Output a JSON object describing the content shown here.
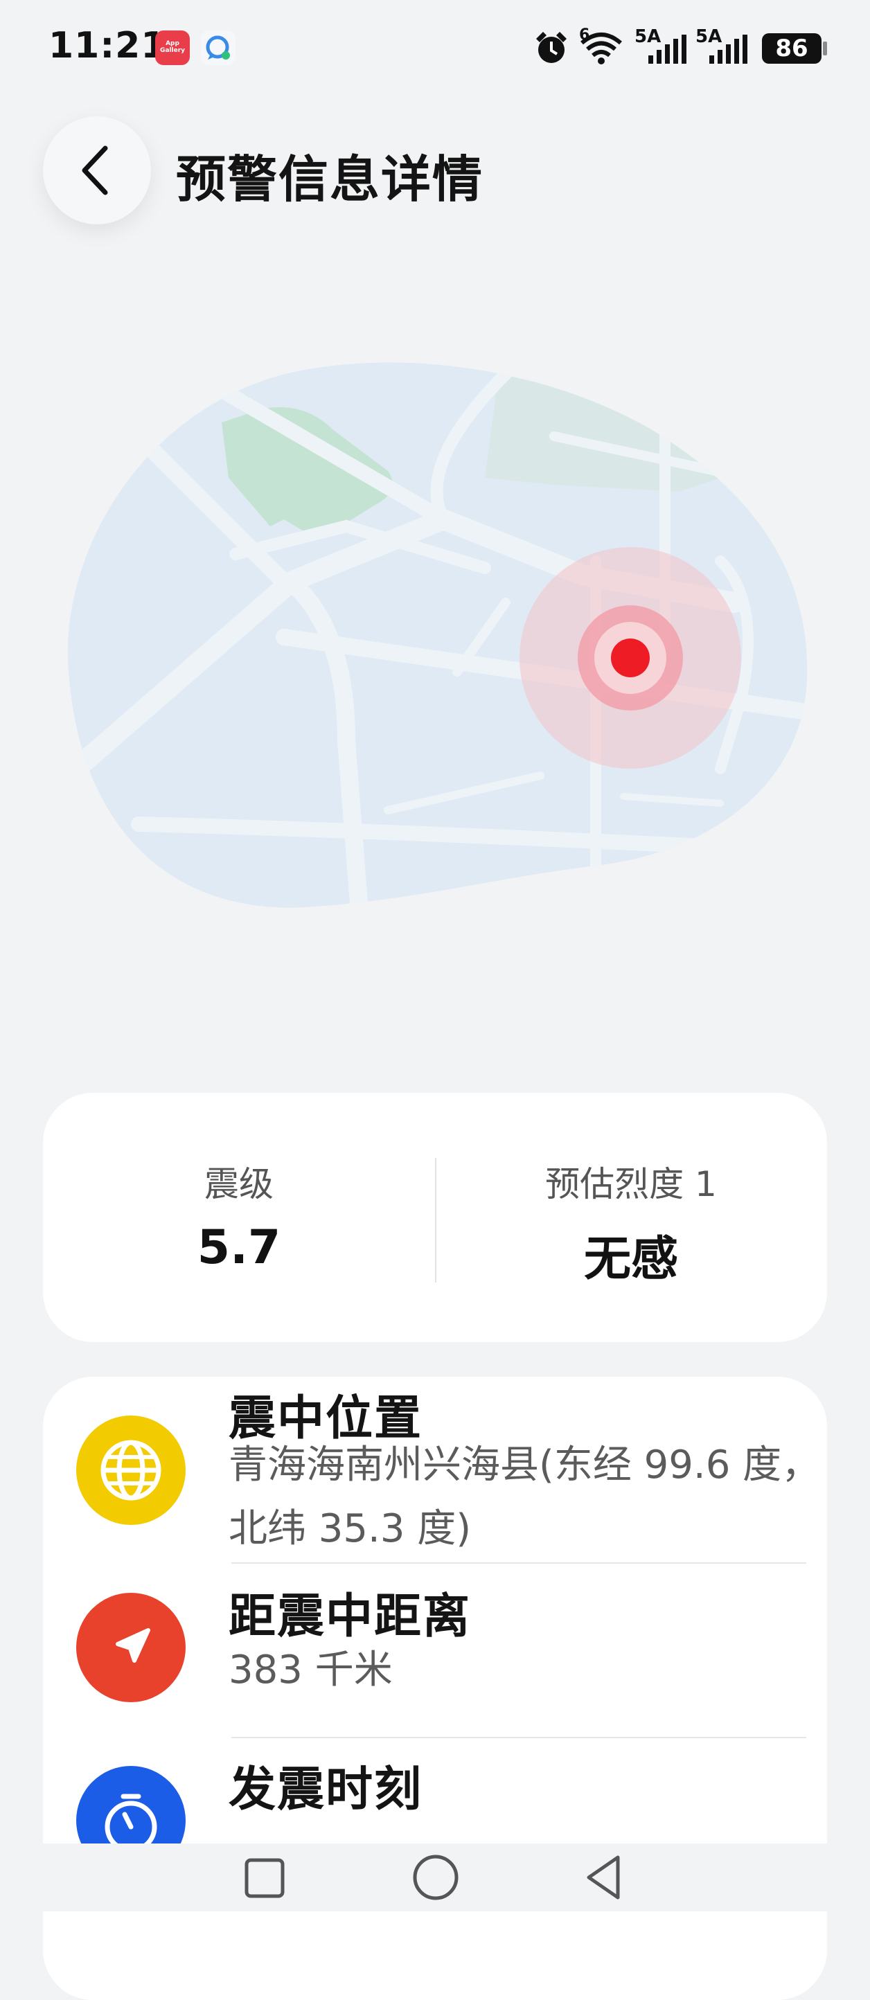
{
  "status_bar": {
    "time": "11:21",
    "app_gallery_label": "App Gallery",
    "network_1": "6",
    "network_2": "5A",
    "network_3": "5A",
    "battery": "86"
  },
  "header": {
    "title": "预警信息详情"
  },
  "summary": {
    "magnitude_label": "震级",
    "magnitude_value": "5.7",
    "intensity_label": "预估烈度 1",
    "intensity_value": "无感"
  },
  "details": [
    {
      "title": "震中位置",
      "value": "青海海南州兴海县(东经 99.6 度，北纬 35.3 度)",
      "icon": "globe-icon",
      "color": "#f2cc00"
    },
    {
      "title": "距震中距离",
      "value": "383 千米",
      "icon": "navigation-icon",
      "color": "#e8412c"
    },
    {
      "title": "发震时刻",
      "value": "",
      "icon": "stopwatch-icon",
      "color": "#1c5de8"
    }
  ],
  "colors": {
    "background": "#f1f3f5",
    "epicenter": "#ee1c25",
    "map_land": "#dfeaf4",
    "map_park": "#c5e3d3"
  }
}
